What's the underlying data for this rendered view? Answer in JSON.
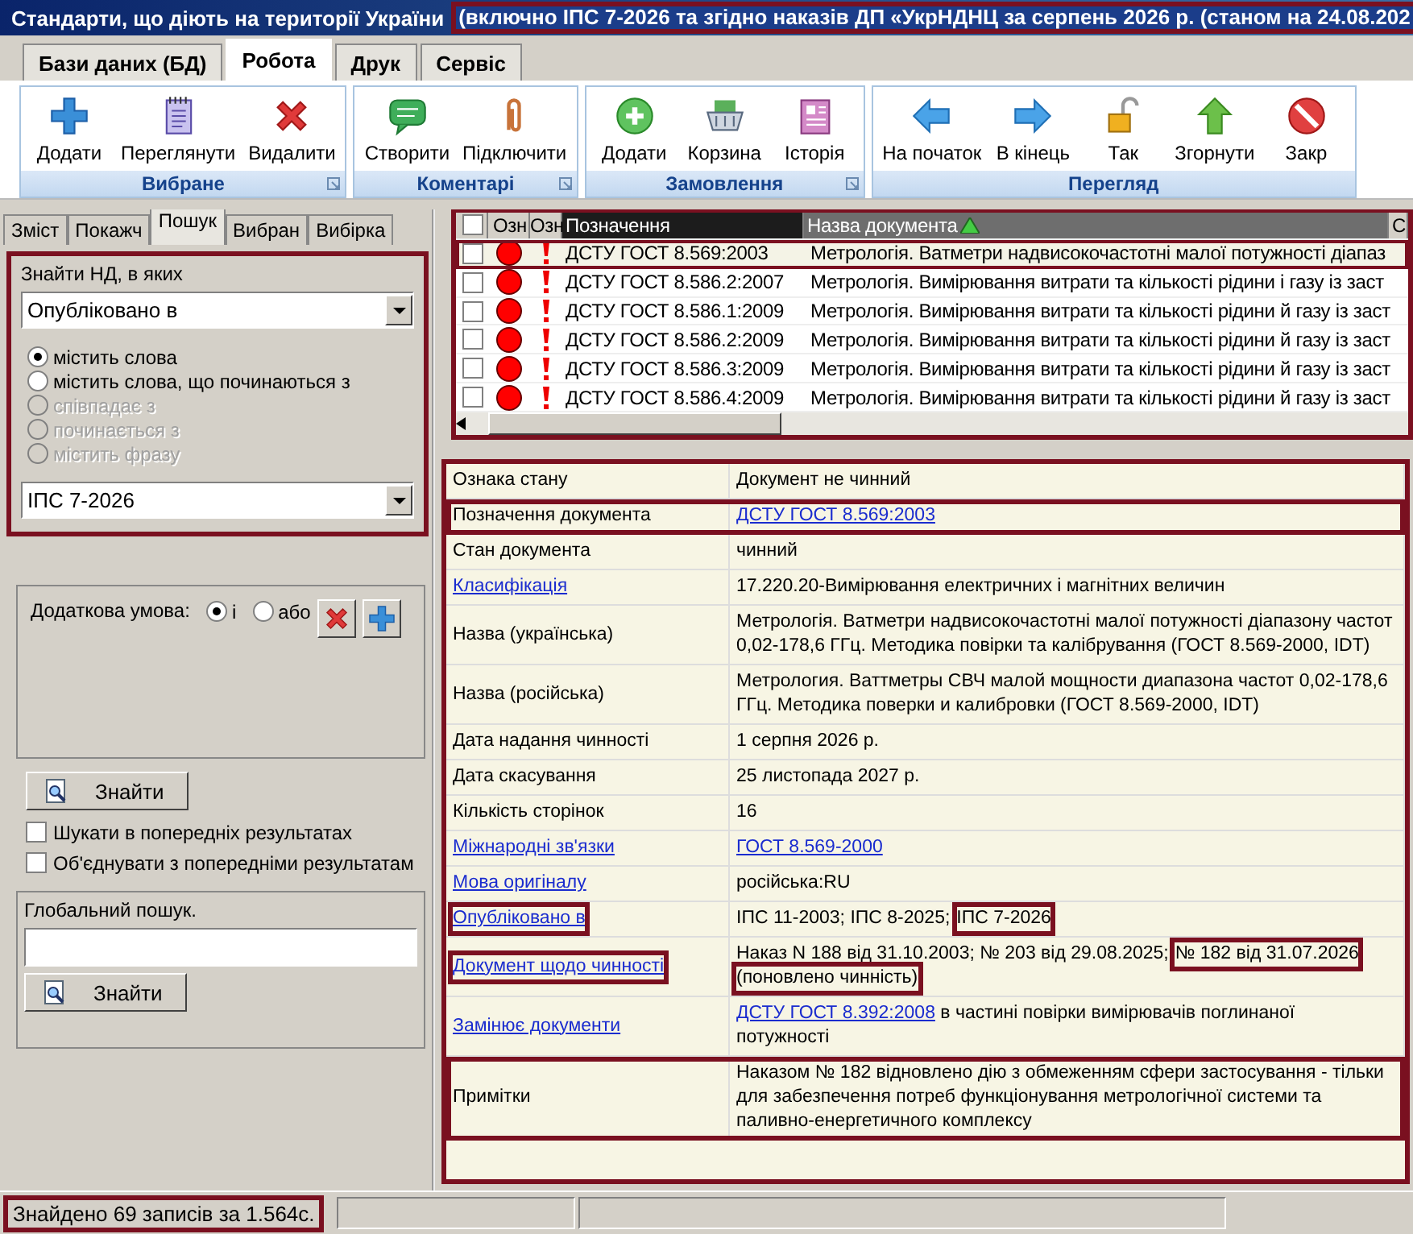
{
  "window": {
    "title": "Стандарти, що діють на території України",
    "title_note": "(включно ІПС 7-2026 та згідно наказів ДП «УкрНДНЦ за серпень 2026 р. (станом на 24.08.202"
  },
  "ribbon_tabs": [
    {
      "label": "Бази даних (БД)",
      "selected": false
    },
    {
      "label": "Робота",
      "selected": true
    },
    {
      "label": "Друк",
      "selected": false
    },
    {
      "label": "Сервіс",
      "selected": false
    }
  ],
  "ribbon_groups": [
    {
      "title": "Вибране",
      "buttons": [
        "Додати",
        "Переглянути",
        "Видалити"
      ]
    },
    {
      "title": "Коментарі",
      "buttons": [
        "Створити",
        "Підключити"
      ]
    },
    {
      "title": "Замовлення",
      "buttons": [
        "Додати",
        "Корзина",
        "Історія"
      ]
    },
    {
      "title": "Перегляд",
      "buttons": [
        "На початок",
        "В кінець",
        "Так",
        "Згорнути",
        "Закр"
      ]
    }
  ],
  "left_tabs": [
    {
      "label": "Зміст",
      "selected": false
    },
    {
      "label": "Покажч",
      "selected": false
    },
    {
      "label": "Пошук",
      "selected": true
    },
    {
      "label": "Вибран",
      "selected": false
    },
    {
      "label": "Вибірка",
      "selected": false
    }
  ],
  "search": {
    "label": "Знайти НД, в яких",
    "field": "Опубліковано в",
    "options": [
      {
        "label": "містить слова",
        "selected": true,
        "disabled": false
      },
      {
        "label": "містить слова, що починаються з",
        "selected": false,
        "disabled": false
      },
      {
        "label": "співпадає з",
        "selected": false,
        "disabled": true
      },
      {
        "label": "починається з",
        "selected": false,
        "disabled": true
      },
      {
        "label": "містить фразу",
        "selected": false,
        "disabled": true
      }
    ],
    "value": "ІПС 7-2026"
  },
  "extra_condition": {
    "label": "Додаткова умова:",
    "options": [
      {
        "label": "і",
        "selected": true
      },
      {
        "label": "або",
        "selected": false
      }
    ]
  },
  "find_button": "Знайти",
  "checkboxes": [
    {
      "label": "Шукати в попередніх результатах",
      "checked": false
    },
    {
      "label": "Об'єднувати з попередніми результатам",
      "checked": false
    }
  ],
  "global_search": {
    "label": "Глобальний пошук.",
    "button": "Знайти"
  },
  "table": {
    "header_checked": false,
    "columns": [
      "Озн",
      "Озн",
      "Позначення",
      "Назва документа",
      "С"
    ],
    "rows": [
      {
        "selected": true,
        "checked": false,
        "designation": "ДСТУ ГОСТ 8.569:2003",
        "title": "Метрологія. Ватметри надвисокочастотні малої потужності діапаз"
      },
      {
        "selected": false,
        "checked": false,
        "designation": "ДСТУ ГОСТ 8.586.2:2007",
        "title": "Метрологія. Вимірювання витрати та кількості рідини і газу із заст"
      },
      {
        "selected": false,
        "checked": false,
        "designation": "ДСТУ ГОСТ 8.586.1:2009",
        "title": "Метрологія. Вимірювання витрати та кількості рідини й газу із заст"
      },
      {
        "selected": false,
        "checked": false,
        "designation": "ДСТУ ГОСТ 8.586.2:2009",
        "title": "Метрологія. Вимірювання витрати та кількості рідини й газу із заст"
      },
      {
        "selected": false,
        "checked": false,
        "designation": "ДСТУ ГОСТ 8.586.3:2009",
        "title": "Метрологія. Вимірювання витрати та кількості рідини й газу із заст"
      },
      {
        "selected": false,
        "checked": false,
        "designation": "ДСТУ ГОСТ 8.586.4:2009",
        "title": "Метрологія. Вимірювання витрати та кількості рідини й газу із заст"
      }
    ]
  },
  "details": [
    {
      "label": "Ознака стану",
      "link": false,
      "highlighted": false,
      "value": [
        {
          "text": "Документ не чинний"
        }
      ]
    },
    {
      "label": "Позначення документа",
      "link": false,
      "highlighted": true,
      "value": [
        {
          "text": "ДСТУ ГОСТ 8.569:2003",
          "kind": "link"
        }
      ]
    },
    {
      "label": "Стан документа",
      "link": false,
      "highlighted": false,
      "value": [
        {
          "text": "чинний"
        }
      ]
    },
    {
      "label": "Класифікація",
      "link": true,
      "highlighted": false,
      "value": [
        {
          "text": "17.220.20-Вимірювання електричних і магнітних величин"
        }
      ]
    },
    {
      "label": "Назва (українська)",
      "link": false,
      "highlighted": false,
      "value": [
        {
          "text": "Метрологія. Ватметри надвисокочастотні малої потужності діапазону частот 0,02-178,6 ГГц. Методика повірки та калібрування (ГОСТ 8.569-2000, IDT)"
        }
      ]
    },
    {
      "label": "Назва (російська)",
      "link": false,
      "highlighted": false,
      "value": [
        {
          "text": "Метрология. Ваттметры СВЧ малой мощности диапазона частот 0,02-178,6 ГГц. Методика поверки и калибровки (ГОСТ 8.569-2000, IDT)"
        }
      ]
    },
    {
      "label": "Дата надання чинності",
      "link": false,
      "highlighted": false,
      "value": [
        {
          "text": "1 серпня 2026 р."
        }
      ]
    },
    {
      "label": "Дата скасування",
      "link": false,
      "highlighted": false,
      "value": [
        {
          "text": "25 листопада 2027 р."
        }
      ]
    },
    {
      "label": "Кількість сторінок",
      "link": false,
      "highlighted": false,
      "value": [
        {
          "text": "16"
        }
      ]
    },
    {
      "label": "Міжнародні зв'язки",
      "link": true,
      "highlighted": false,
      "value": [
        {
          "text": "ГОСТ 8.569-2000",
          "kind": "link"
        }
      ]
    },
    {
      "label": "Мова оригіналу",
      "link": true,
      "highlighted": false,
      "value": [
        {
          "text": "російська:RU"
        }
      ]
    },
    {
      "label": "Опубліковано в",
      "link": true,
      "label_highlighted": true,
      "highlighted": false,
      "value": [
        {
          "text": "ІПС 11-2003; ІПС 8-2025;"
        },
        {
          "text": "ІПС 7-2026",
          "kind": "mark"
        }
      ]
    },
    {
      "label": "Документ щодо чинності",
      "link": true,
      "label_highlighted": true,
      "highlighted": false,
      "value": [
        {
          "text": "Наказ N 188 від 31.10.2003; № 203 від 29.08.2025;"
        },
        {
          "text": "№ 182 від 31.07.2026",
          "kind": "mark"
        },
        {
          "text": "(поновлено чинність)",
          "kind": "mark"
        }
      ]
    },
    {
      "label": "Замінює документи",
      "link": true,
      "highlighted": false,
      "value": [
        {
          "text": "ДСТУ ГОСТ 8.392:2008",
          "kind": "link"
        },
        {
          "text": "в частині повірки вимірювачів поглинаної потужності"
        }
      ]
    },
    {
      "label": "Примітки",
      "link": false,
      "highlighted": true,
      "value": [
        {
          "text": "Наказом № 182 відновлено дію з обмеженням сфери застосування - тільки для забезпечення потреб функціонування метрологічної системи та паливно-енергетичного комплексу"
        }
      ]
    }
  ],
  "status_bar": {
    "text": "Знайдено 69 записів за 1.564с."
  }
}
